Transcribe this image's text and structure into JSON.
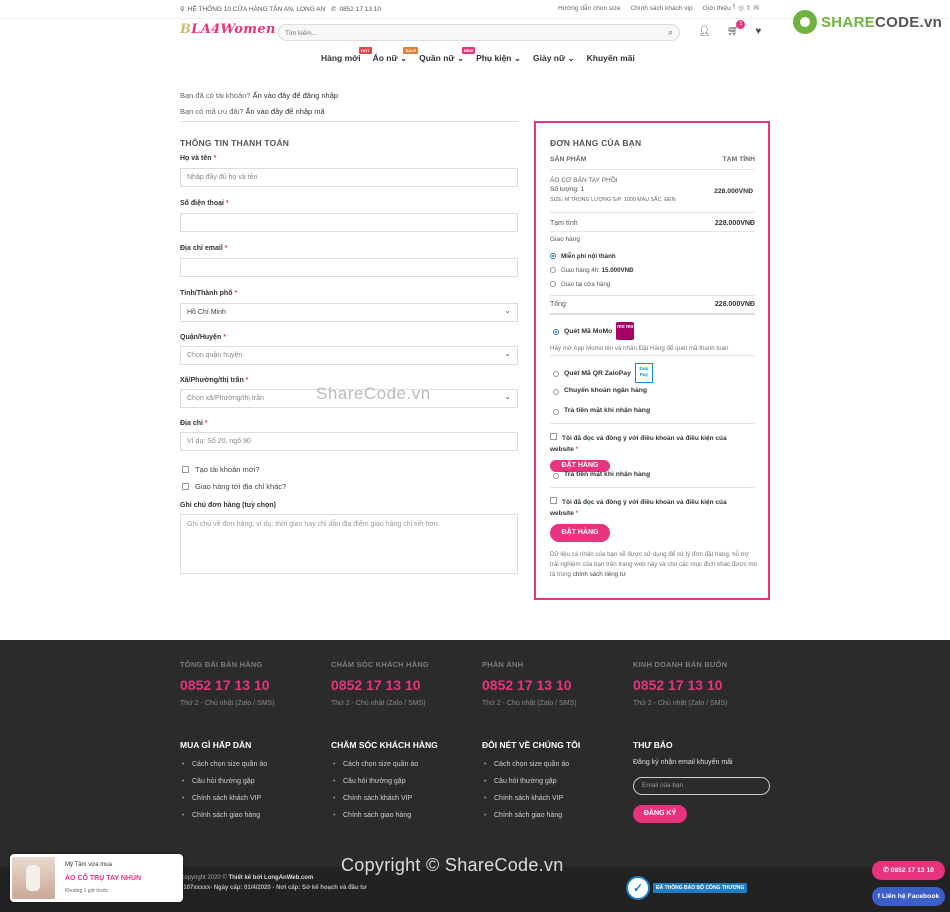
{
  "topbar": {
    "address": "HỆ THỐNG 10 CỬA HÀNG TÂN AN, LONG AN",
    "phone": "0852 17 13 10",
    "links": [
      "Hướng dẫn chọn size",
      "Chính sách khách vip",
      "Giới thiệu"
    ]
  },
  "header": {
    "logo_prefix": "B",
    "logo_text": "LA4Women",
    "search_placeholder": "Tìm kiếm...",
    "cart_count": "1"
  },
  "brandmark": {
    "part1": "SHARE",
    "part2": "CODE.vn"
  },
  "nav": [
    {
      "label": "Hàng mới",
      "tag": "HOT",
      "tag_color": "#e04a4a"
    },
    {
      "label": "Áo nữ",
      "tag": "SALE",
      "tag_color": "#e0803a"
    },
    {
      "label": "Quần nữ",
      "tag": "NEW",
      "tag_color": "#e8337f"
    },
    {
      "label": "Phụ kiện",
      "tag": "",
      "tag_color": ""
    },
    {
      "label": "Giày nữ",
      "tag": "",
      "tag_color": ""
    },
    {
      "label": "Khuyến mãi",
      "tag": "",
      "tag_color": ""
    }
  ],
  "notices": {
    "login_q": "Bạn đã có tài khoản?",
    "login_link": "Ấn vào đây để đăng nhập",
    "coupon_q": "Bạn có mã ưu đãi?",
    "coupon_link": "Ấn vào đây để nhập mã"
  },
  "billing": {
    "title": "THÔNG TIN THANH TOÁN",
    "name_label": "Họ và tên",
    "name_placeholder": "Nhập đầy đủ họ và tên",
    "phone_label": "Số điện thoại",
    "email_label": "Địa chỉ email",
    "city_label": "Tỉnh/Thành phố",
    "city_value": "Hồ Chí Minh",
    "district_label": "Quận/Huyện",
    "district_placeholder": "Chọn quận huyện",
    "ward_label": "Xã/Phường/thị trấn",
    "ward_placeholder": "Chọn xã/Phường/thị trấn",
    "address_label": "Địa chỉ",
    "address_placeholder": "Ví dụ: Số 20, ngõ 90",
    "create_account": "Tạo tài khoản mới?",
    "ship_other": "Giao hàng tới địa chỉ khác?",
    "notes_label": "Ghi chú đơn hàng (tuỳ chọn)",
    "notes_placeholder": "Ghi chú về đơn hàng, ví dụ: thời gian hay chỉ dẫn địa điểm giao hàng chi tiết hơn.",
    "required_mark": "*"
  },
  "order": {
    "title": "ĐƠN HÀNG CỦA BẠN",
    "col_product": "SẢN PHẨM",
    "col_total": "TẠM TÍNH",
    "product_name": "ÁO CƠ BẢN TAY PHỒI",
    "product_qty": "Số lượng: 1",
    "product_attrs": "SIZE:  M   TRỌNG LƯỢNG S/P:  1000   MÀU SẮC:  ĐEN",
    "product_price": "228.000VNĐ",
    "subtotal_label": "Tạm tính",
    "subtotal_value": "228.000VNĐ",
    "shipping_label": "Giao hàng",
    "shipping_options": [
      "Miễn phí nội thành",
      "Giao hàng 4h:",
      "Giao tại cửa hàng"
    ],
    "shipping_4h_price": "15.000VNĐ",
    "total_label": "Tổng",
    "total_value": "228.000VNĐ",
    "pay_momo": "Quét Mã MoMo",
    "momo_logo": "mo mo",
    "momo_desc": "Hãy mở App Momo lên và nhấn Đặt Hàng để quét mã thanh toán",
    "pay_zalo": "Quét Mã QR ZaloPay",
    "zalo_logo": "Zalo Pay",
    "pay_bank": "Chuyển khoản ngân hàng",
    "pay_cod": "Trả tiền mặt khi nhận hàng",
    "agree_text": "Tôi đã đọc và đồng ý với điều khoản và điều kiện của website",
    "agree_mark": "*",
    "order_btn": "ĐẶT HÀNG",
    "privacy_text": "Dữ liệu cá nhân của bạn sẽ được sử dụng để xử lý đơn đặt hàng, hỗ trợ trải nghiệm của bạn trên trang web này và cho các mục đích khác được mô tả trong",
    "privacy_link": "chính sách riêng tư"
  },
  "watermark_center": "ShareCode.vn",
  "footer": {
    "contacts": [
      {
        "title": "TỔNG ĐÀI BÁN HÀNG",
        "phone": "0852 17 13 10",
        "sub": "Thứ 2 - Chủ nhật (Zalo / SMS)"
      },
      {
        "title": "CHĂM SÓC KHÁCH HÀNG",
        "phone": "0852 17 13 10",
        "sub": "Thứ 2 - Chủ nhật (Zalo / SMS)"
      },
      {
        "title": "PHẢN ÁNH",
        "phone": "0852 17 13 10",
        "sub": "Thứ 2 - Chủ nhật (Zalo / SMS)"
      },
      {
        "title": "KINH DOANH BÁN BUÔN",
        "phone": "0852 17 13 10",
        "sub": "Thứ 2 - Chủ nhật (Zalo / SMS)"
      }
    ],
    "cols": [
      {
        "title": "MUA GÌ HẤP DẪN",
        "items": [
          "Cách chọn size quần áo",
          "Câu hỏi thường gặp",
          "Chính sách khách VIP",
          "Chính sách giao hàng"
        ]
      },
      {
        "title": "CHĂM SÓC KHÁCH HÀNG",
        "items": [
          "Cách chọn size quần áo",
          "Câu hỏi thường gặp",
          "Chính sách khách VIP",
          "Chính sách giao hàng"
        ]
      },
      {
        "title": "ĐÔI NÉT VỀ CHÚNG TÔI",
        "items": [
          "Cách chọn size quần áo",
          "Câu hỏi thường gặp",
          "Chính sách khách VIP",
          "Chính sách giao hàng"
        ]
      }
    ],
    "newsletter_title": "THƯ BÁO",
    "newsletter_text": "Đăng ký nhận email khuyến mãi",
    "newsletter_placeholder": "Email của bạn",
    "newsletter_btn": "ĐĂNG KÝ",
    "copyright_prefix": "Copyright 2020 ©",
    "copyright_link": "Thiết kế bởi LongAnWeb.com",
    "license_line": "0107xxxxx- Ngày cấp: 01/4/2020 - Nơi cấp: Sở kế hoạch và đầu tư",
    "big_copy": "Copyright © ShareCode.vn",
    "gov_badge": "ĐÃ THÔNG BÁO BỘ CÔNG THƯƠNG"
  },
  "popup": {
    "line1": "Mỹ Tâm vừa mua",
    "line2": "ÁO CỔ TRỤ TAY NHÚN",
    "line3": "Khoảng 1 giờ trước"
  },
  "floating": {
    "call": "0852 17 13 10",
    "facebook": "Liên hệ Facebook",
    "call_color": "#e8337f",
    "facebook_color": "#3b5ec7"
  }
}
